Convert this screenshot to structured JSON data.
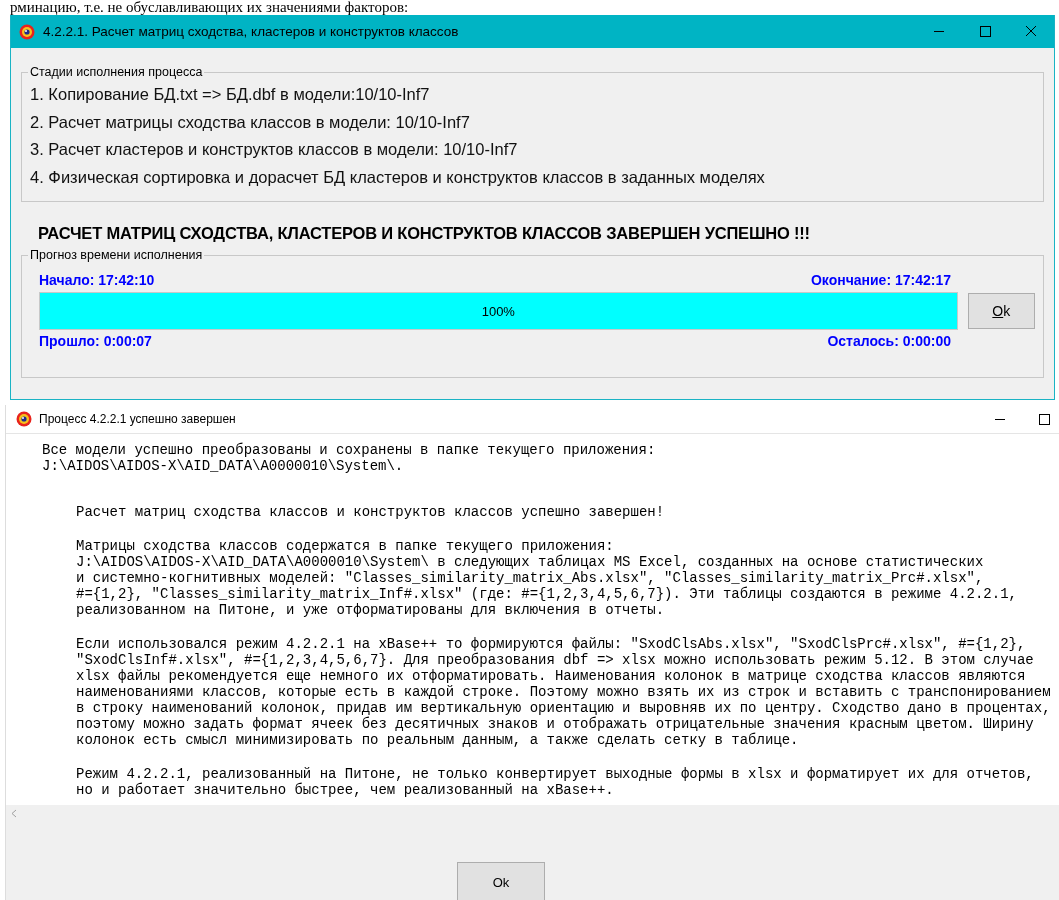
{
  "document_text": "рминацию, т.е. не обуславливающих их значениями факторов:",
  "progress_window": {
    "title": "4.2.2.1. Расчет матриц сходства, кластеров и конструктов классов",
    "stages_group": {
      "legend": "Стадии исполнения процесса",
      "items": [
        "1. Копирование БД.txt => БД.dbf в модели:10/10-Inf7",
        "2. Расчет матрицы сходства классов в модели: 10/10-Inf7",
        "3. Расчет кластеров и конструктов классов в модели: 10/10-Inf7",
        "4. Физическая сортировка и дорасчет БД кластеров и конструктов классов в заданных моделях"
      ]
    },
    "status_message": "РАСЧЕТ МАТРИЦ СХОДСТВА, КЛАСТЕРОВ И КОНСТРУКТОВ КЛАССОВ ЗАВЕРШЕН УСПЕШНО !!!",
    "time_group": {
      "legend": "Прогноз времени исполнения",
      "start": "Начало: 17:42:10",
      "end": "Окончание: 17:42:17",
      "progress": {
        "level": 1,
        "label": "100%"
      },
      "elapsed": "Прошло: 0:00:07",
      "remaining": "Осталось: 0:00:00"
    },
    "ok_button": "Ok"
  },
  "result_window": {
    "title": "Процесс 4.2.2.1 успешно завершен",
    "intro_lines": [
      "Все модели успешно преобразованы и сохранены в папке текущего приложения:",
      "J:\\AIDOS\\AIDOS-X\\AID_DATA\\A0000010\\System\\."
    ],
    "paragraphs": [
      [
        "Расчет матриц сходства классов и конструктов классов успешно завершен!"
      ],
      [
        "Матрицы сходства классов содержатся в папке текущего приложения:",
        "J:\\AIDOS\\AIDOS-X\\AID_DATA\\A0000010\\System\\ в следующих таблицах MS Excel, созданных на основе статистических",
        "и системно-когнитивных моделей: \"Classes_similarity_matrix_Abs.xlsx\", \"Classes_similarity_matrix_Prc#.xlsx\",",
        "#={1,2}, \"Classes_similarity_matrix_Inf#.xlsx\" (где: #={1,2,3,4,5,6,7}). Эти таблицы создаются в режиме 4.2.2.1,",
        "реализованном на Питоне, и уже отформатированы для включения в отчеты."
      ],
      [
        "Если использовался режим 4.2.2.1 на xBase++ то формируются файлы: \"SxodClsAbs.xlsx\", \"SxodClsPrc#.xlsx\", #={1,2},",
        "\"SxodClsInf#.xlsx\", #={1,2,3,4,5,6,7}. Для преобразования dbf => xlsx можно использовать режим 5.12. В этом случае",
        "xlsx файлы рекомендуется еще немного их отформатировать. Наименования колонок в матрице сходства классов являются",
        "наименованиями классов, которые есть в каждой строке. Поэтому можно взять их из строк и вставить с транспонированием",
        "в строку наименований колонок, придав им вертикальную ориентацию и выровняв их по центру. Сходство дано в процентах,",
        "поэтому можно задать формат ячеек без десятичных знаков и отображать отрицательные значения красным цветом. Ширину",
        "колонок есть смысл минимизировать по реальным данным, а также сделать сетку в таблице."
      ],
      [
        "Режим 4.2.2.1, реализованный на Питоне, не только конвертирует выходные формы в xlsx и форматирует их для отчетов,",
        "но и работает значительно быстрее, чем реализованный на xBase++."
      ]
    ],
    "ok_button": "Ok"
  }
}
